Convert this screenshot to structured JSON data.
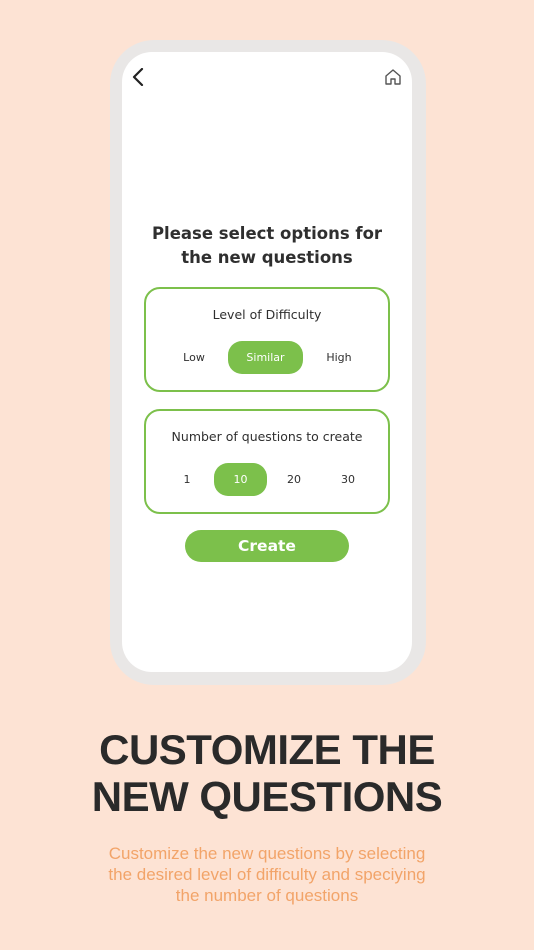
{
  "screen": {
    "prompt": "Please select options for\nthe new questions",
    "back_icon": "chevron-left-icon",
    "home_icon": "home-icon"
  },
  "difficulty": {
    "title": "Level of Difficulty",
    "options": [
      "Low",
      "Similar",
      "High"
    ],
    "selected": "Similar"
  },
  "count": {
    "title": "Number of questions to create",
    "options": [
      "1",
      "10",
      "20",
      "30"
    ],
    "selected": "10"
  },
  "create_label": "Create",
  "headline": "CUSTOMIZE THE\nNEW QUESTIONS",
  "subtext": "Customize the new questions by selecting\nthe desired level of difficulty and speciying\nthe number of questions",
  "colors": {
    "accent": "#7cc04b",
    "background": "#fde3d4",
    "subtext": "#f2a469"
  }
}
